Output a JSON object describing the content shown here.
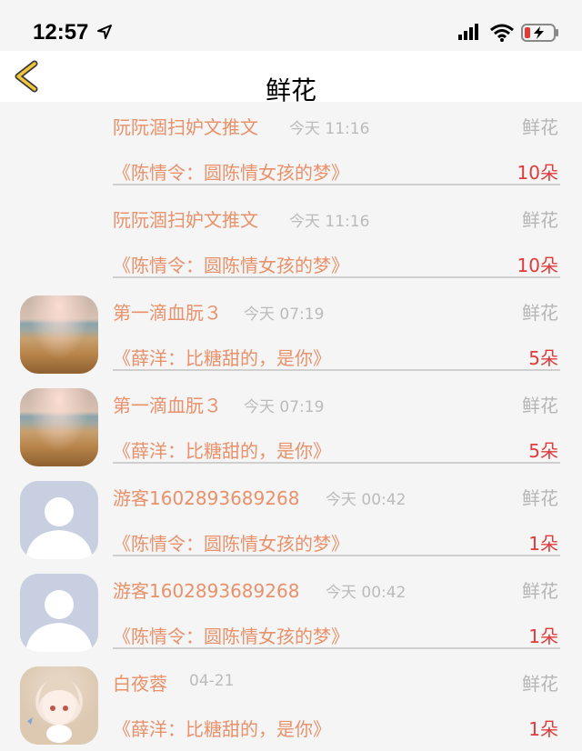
{
  "status_bar": {
    "time": "12:57"
  },
  "nav": {
    "title": "鲜花"
  },
  "items": [
    {
      "avatar": "none",
      "name": "阮阮涸扫妒文推文",
      "time": "今天 11:16",
      "gift_type": "鲜花",
      "book": "《陈情令：圆陈情女孩的梦》",
      "count": "10朵"
    },
    {
      "avatar": "none",
      "name": "阮阮涸扫妒文推文",
      "time": "今天 11:16",
      "gift_type": "鲜花",
      "book": "《陈情令：圆陈情女孩的梦》",
      "count": "10朵"
    },
    {
      "avatar": "beach",
      "name": "第一滴血朊３",
      "time": "今天 07:19",
      "gift_type": "鲜花",
      "book": "《薛洋：比糖甜的，是你》",
      "count": "5朵"
    },
    {
      "avatar": "beach",
      "name": "第一滴血朊３",
      "time": "今天 07:19",
      "gift_type": "鲜花",
      "book": "《薛洋：比糖甜的，是你》",
      "count": "5朵"
    },
    {
      "avatar": "guest",
      "name": "游客1602893689268",
      "time": "今天 00:42",
      "gift_type": "鲜花",
      "book": "《陈情令：圆陈情女孩的梦》",
      "count": "1朵"
    },
    {
      "avatar": "guest",
      "name": "游客1602893689268",
      "time": "今天 00:42",
      "gift_type": "鲜花",
      "book": "《陈情令：圆陈情女孩的梦》",
      "count": "1朵"
    },
    {
      "avatar": "anime",
      "name": "白夜蓉",
      "time": "04-21",
      "gift_type": "鲜花",
      "book": "《薛洋：比糖甜的，是你》",
      "count": "1朵"
    }
  ]
}
